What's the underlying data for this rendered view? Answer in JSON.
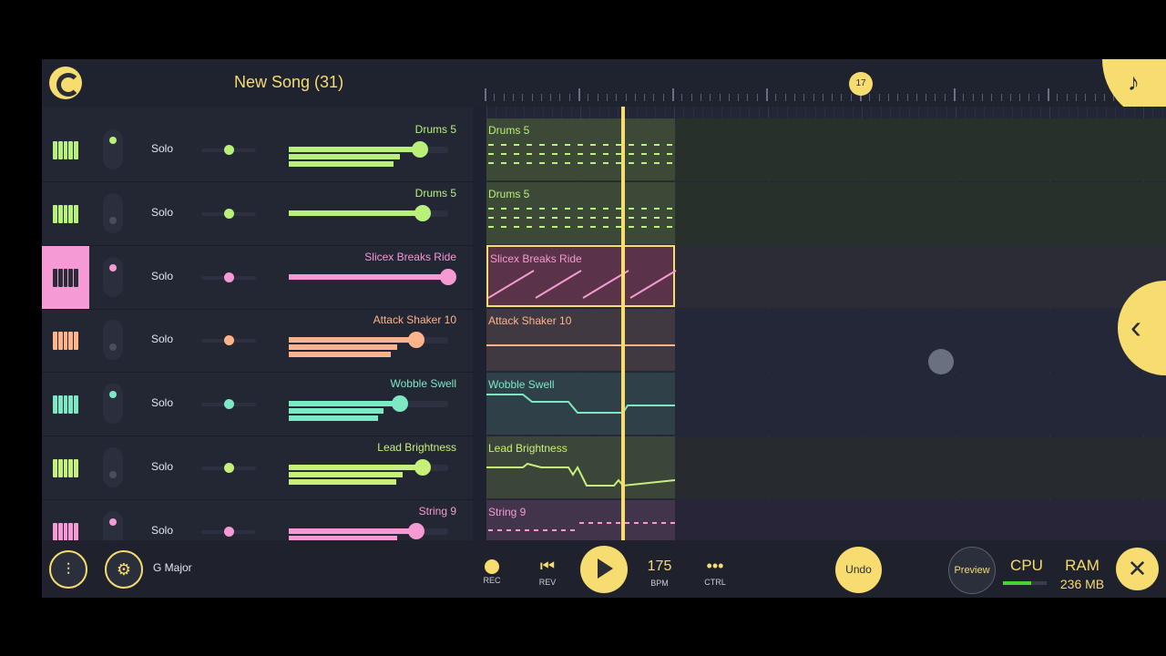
{
  "header": {
    "song_title": "New Song (31)",
    "marker": "17"
  },
  "colors": {
    "accent": "#f7dc6f"
  },
  "tracks": [
    {
      "name": "Drums 5",
      "solo": "Solo",
      "color": "#b8f07a",
      "vol": 0.82,
      "icon": "drum-pad-icon"
    },
    {
      "name": "Drums 5",
      "solo": "Solo",
      "color": "#b8f07a",
      "vol": 0.84,
      "icon": "drum-pad-icon"
    },
    {
      "name": "Slicex Breaks Ride",
      "solo": "Solo",
      "color": "#f59ad4",
      "vol": 1.0,
      "icon": "piano-icon"
    },
    {
      "name": "Attack Shaker 10",
      "solo": "Solo",
      "color": "#ffb38a",
      "vol": 0.8,
      "icon": "piano-icon"
    },
    {
      "name": "Wobble Swell",
      "solo": "Solo",
      "color": "#7de8c4",
      "vol": 0.7,
      "icon": "piano-icon"
    },
    {
      "name": "Lead Brightness",
      "solo": "Solo",
      "color": "#c7f07a",
      "vol": 0.84,
      "icon": "piano-icon"
    },
    {
      "name": "String 9",
      "solo": "Solo",
      "color": "#f59ad4",
      "vol": 0.8,
      "icon": "piano-icon"
    }
  ],
  "footer": {
    "scale": "G Major",
    "rec": "REC",
    "rev": "REV",
    "bpm_value": "175",
    "bpm_label": "BPM",
    "ctrl": "CTRL",
    "undo": "Undo",
    "preview": "Preview",
    "cpu": "CPU",
    "cpu_level": 0.65,
    "ram": "RAM",
    "ram_value": "236 MB"
  }
}
